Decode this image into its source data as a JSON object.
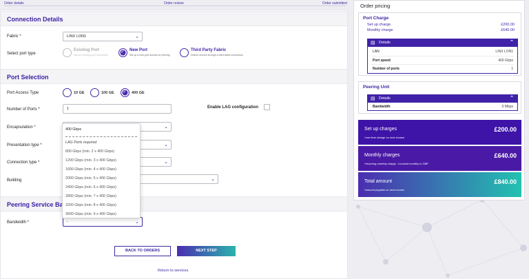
{
  "steps": [
    "Order details",
    "Order review",
    "Order submitted"
  ],
  "connection": {
    "title": "Connection Details",
    "fabric_label": "Fabric *",
    "fabric_value": "LINX LON1",
    "port_type_label": "Select port type",
    "port_types": [
      {
        "title": "Existing Port",
        "sub": "Use an existing port connection"
      },
      {
        "title": "New Port",
        "sub": "Set up a new port access for peering"
      },
      {
        "title": "Third Party Fabric",
        "sub": "Deliver service through a third fabric connection"
      }
    ]
  },
  "port_selection": {
    "title": "Port Selection",
    "access_label": "Port Access Type",
    "access_options": [
      "10 GE",
      "100 GE",
      "400 GE"
    ],
    "num_ports_label": "Number of Ports *",
    "num_ports_value": "1",
    "lag_label": "Enable LAG configuration",
    "encapsulation_label": "Encapsulation *",
    "presentation_label": "Presentation type *",
    "connection_type_label": "Connection type *",
    "building_label": "Building"
  },
  "dropdown": {
    "selected": "400 Gbps",
    "group": "LAG Ports required",
    "items": [
      "800 Gbps (min. 2 x 400 Gbps)",
      "1200 Gbps (min. 3 x 400 Gbps)",
      "1600 Gbps (min. 4 x 400 Gbps)",
      "2000 Gbps (min. 5 x 400 Gbps)",
      "2400 Gbps (min. 6 x 400 Gbps)",
      "2800 Gbps (min. 7 x 400 Gbps)",
      "3200 Gbps (min. 8 x 400 Gbps)",
      "3600 Gbps (min. 9 x 400 Gbps)"
    ]
  },
  "peering": {
    "title": "Peering Service Band",
    "bandwidth_label": "Bandwidth *",
    "bandwidth_value": "-"
  },
  "buttons": {
    "back": "BACK TO ORDERS",
    "next": "NEXT STEP",
    "return": "Return to services"
  },
  "pricing": {
    "title": "Order pricing",
    "port_charge": {
      "title": "Port Charge",
      "setup_label": "Set up charge",
      "setup_value": "£200.00",
      "monthly_label": "Monthly charge",
      "monthly_value": "£640.00",
      "details_label": "Details",
      "rows": [
        {
          "k": "LAN",
          "v": "LINX LON1"
        },
        {
          "k": "Port speed",
          "v": "400 Gbps"
        },
        {
          "k": "Number of ports",
          "v": "1"
        }
      ]
    },
    "peering_unit": {
      "title": "Peering Unit",
      "details_label": "Details",
      "rows": [
        {
          "k": "Bandwidth",
          "v": "0 Mbps"
        }
      ]
    },
    "summary": [
      {
        "title": "Set up charges",
        "value": "£200.00",
        "sub": "*one time charge on next invoice",
        "color": "#3d13a8"
      },
      {
        "title": "Monthly charges",
        "value": "£640.00",
        "sub": "*recurring monthly charge - invoiced monthly in GBP",
        "color": "#4a1aa6"
      },
      {
        "title": "Total amount",
        "value": "£840.00",
        "sub": "*amount payable on next invoice",
        "gradient": [
          "#4b2db0",
          "#22c2b0"
        ]
      }
    ]
  }
}
